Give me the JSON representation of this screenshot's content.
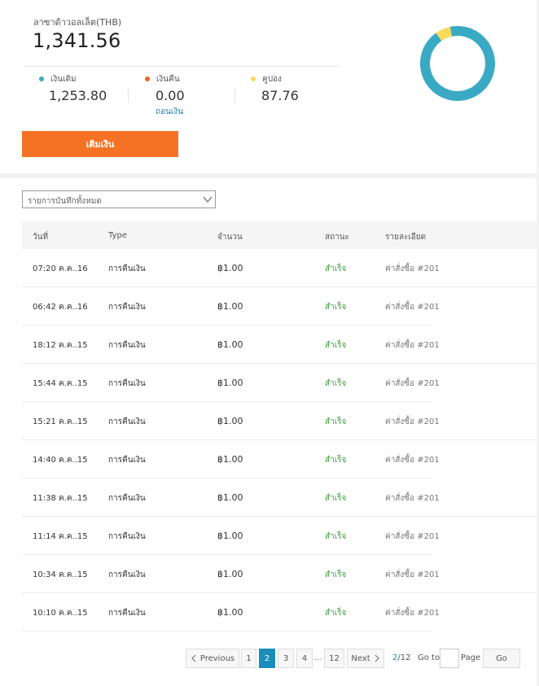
{
  "wallet": {
    "title": "ลาซาด้าวอลเล็ต(THB)",
    "total": "1,341.56",
    "topup_label": "เติมเงิน",
    "breakdown": [
      {
        "label": "เงินเติม",
        "value": "1,253.80",
        "color": "#3aa9c4"
      },
      {
        "label": "เงินคืน",
        "value": "0.00",
        "color": "#f26522",
        "link": "ถอนเงิน"
      },
      {
        "label": "คูปอง",
        "value": "87.76",
        "color": "#f7dc5a"
      }
    ],
    "donut": {
      "segments": [
        1253.8,
        0.0,
        87.76
      ],
      "colors": [
        "#3aa9c4",
        "#f26522",
        "#f7dc5a"
      ]
    }
  },
  "filter": {
    "selected": "รายการบันทึกทั้งหมด",
    "icon": "chevron-down-icon"
  },
  "table": {
    "headers": [
      "วันที่",
      "Type",
      "จำนวน",
      "สถานะ",
      "รายละเอียด"
    ],
    "rows": [
      {
        "date": "07:20 ค.ค..16",
        "type": "การคืนเงิน",
        "amount": "฿1.00",
        "status": "สำเร็จ",
        "detail": "ค่าสั่งซื้อ #201"
      },
      {
        "date": "06:42 ค.ค..16",
        "type": "การคืนเงิน",
        "amount": "฿1.00",
        "status": "สำเร็จ",
        "detail": "ค่าสั่งซื้อ #201"
      },
      {
        "date": "18:12 ค.ค..15",
        "type": "การคืนเงิน",
        "amount": "฿1.00",
        "status": "สำเร็จ",
        "detail": "ค่าสั่งซื้อ #201"
      },
      {
        "date": "15:44 ค.ค..15",
        "type": "การคืนเงิน",
        "amount": "฿1.00",
        "status": "สำเร็จ",
        "detail": "ค่าสั่งซื้อ #201"
      },
      {
        "date": "15:21 ค.ค..15",
        "type": "การคืนเงิน",
        "amount": "฿1.00",
        "status": "สำเร็จ",
        "detail": "ค่าสั่งซื้อ #201"
      },
      {
        "date": "14:40 ค.ค..15",
        "type": "การคืนเงิน",
        "amount": "฿1.00",
        "status": "สำเร็จ",
        "detail": "ค่าสั่งซื้อ #201"
      },
      {
        "date": "11:38 ค.ค..15",
        "type": "การคืนเงิน",
        "amount": "฿1.00",
        "status": "สำเร็จ",
        "detail": "ค่าสั่งซื้อ #201"
      },
      {
        "date": "11:14 ค.ค..15",
        "type": "การคืนเงิน",
        "amount": "฿1.00",
        "status": "สำเร็จ",
        "detail": "ค่าสั่งซื้อ #201"
      },
      {
        "date": "10:34 ค.ค..15",
        "type": "การคืนเงิน",
        "amount": "฿1.00",
        "status": "สำเร็จ",
        "detail": "ค่าสั่งซื้อ #201"
      },
      {
        "date": "10:10 ค.ค..15",
        "type": "การคืนเงิน",
        "amount": "฿1.00",
        "status": "สำเร็จ",
        "detail": "ค่าสั่งซื้อ #201"
      }
    ]
  },
  "pagination": {
    "prev": "Previous",
    "pages": [
      "1",
      "2",
      "3",
      "4",
      "...",
      "12"
    ],
    "active_page": "2",
    "next": "Next",
    "current": "2",
    "total": "/12",
    "goto_label": "Go to",
    "page_label": "Page",
    "go_button": "Go"
  }
}
